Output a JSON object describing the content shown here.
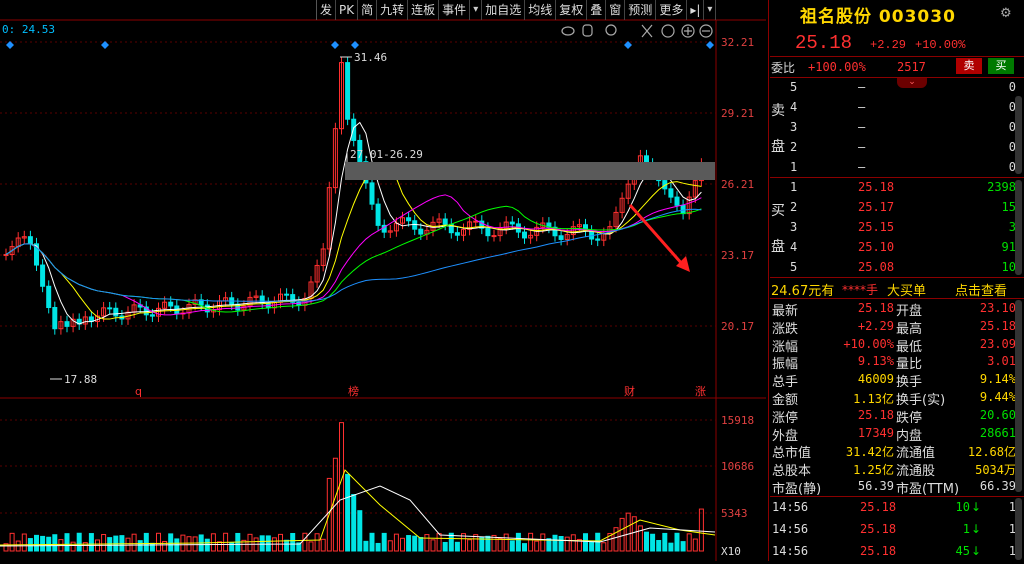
{
  "toolbar": {
    "items": [
      "发",
      "PK",
      "简",
      "九转",
      "连板",
      "事件",
      "▾",
      "加自选",
      "均线",
      "复权",
      "叠",
      "窗",
      "预测",
      "更多",
      "▸|",
      "▾"
    ]
  },
  "chart": {
    "top_left_value": "0: 24.53",
    "price_axis": [
      "32.21",
      "29.21",
      "26.21",
      "23.17",
      "20.17"
    ],
    "volume_axis": [
      "15918",
      "10686",
      "5343",
      "X10"
    ],
    "annotations": {
      "high": "31.46",
      "low": "17.88",
      "range_label": "27.01-26.29"
    },
    "event_markers": [
      "q",
      "榜",
      "财",
      "涨"
    ],
    "tool_icons": [
      "eye-icon",
      "hand-icon",
      "zoom-icon",
      "cut-icon",
      "plus-circle-icon",
      "minus-circle-icon"
    ]
  },
  "stock": {
    "name": "祖名股份",
    "code": "003030",
    "price": "25.18",
    "change": "+2.29",
    "change_pct": "+10.00%"
  },
  "orderbook": {
    "weibi_label": "委比",
    "weibi_value": "+100.00%",
    "weicha_value": "2517",
    "buy_btn": "买",
    "sell_btn": "卖",
    "sell_label_1": "卖",
    "sell_label_2": "盘",
    "buy_label_1": "买",
    "buy_label_2": "盘",
    "asks": [
      {
        "level": "5",
        "price": "–",
        "volume": "0"
      },
      {
        "level": "4",
        "price": "–",
        "volume": "0"
      },
      {
        "level": "3",
        "price": "–",
        "volume": "0"
      },
      {
        "level": "2",
        "price": "–",
        "volume": "0"
      },
      {
        "level": "1",
        "price": "–",
        "volume": "0"
      }
    ],
    "bids": [
      {
        "level": "1",
        "price": "25.18",
        "volume": "2398"
      },
      {
        "level": "2",
        "price": "25.17",
        "volume": "15"
      },
      {
        "level": "3",
        "price": "25.15",
        "volume": "3"
      },
      {
        "level": "4",
        "price": "25.10",
        "volume": "91"
      },
      {
        "level": "5",
        "price": "25.08",
        "volume": "10"
      }
    ]
  },
  "big_order": {
    "price": "24.67元有",
    "mask": "****手",
    "label": "大买单",
    "action": "点击查看"
  },
  "stats": [
    {
      "l1": "最新",
      "v1": "25.18",
      "l2": "开盘",
      "v2": "23.10"
    },
    {
      "l1": "涨跌",
      "v1": "+2.29",
      "l2": "最高",
      "v2": "25.18"
    },
    {
      "l1": "涨幅",
      "v1": "+10.00%",
      "l2": "最低",
      "v2": "23.09"
    },
    {
      "l1": "振幅",
      "v1": "9.13%",
      "l2": "量比",
      "v2": "3.01"
    },
    {
      "l1": "总手",
      "v1": "46009",
      "l2": "换手",
      "v2": "9.14%"
    },
    {
      "l1": "金额",
      "v1": "1.13亿",
      "l2": "换手(实)",
      "v2": "9.44%"
    },
    {
      "l1": "涨停",
      "v1": "25.18",
      "l2": "跌停",
      "v2": "20.60"
    },
    {
      "l1": "外盘",
      "v1": "17349",
      "l2": "内盘",
      "v2": "28661"
    },
    {
      "l1": "总市值",
      "v1": "31.42亿",
      "l2": "流通值",
      "v2": "12.68亿"
    },
    {
      "l1": "总股本",
      "v1": "1.25亿",
      "l2": "流通股",
      "v2": "5034万"
    },
    {
      "l1": "市盈(静)",
      "v1": "56.39",
      "l2": "市盈(TTM)",
      "v2": "66.39"
    }
  ],
  "trades": [
    {
      "time": "14:56",
      "price": "25.18",
      "vol": "10",
      "arrow": "↓",
      "count": "1"
    },
    {
      "time": "14:56",
      "price": "25.18",
      "vol": "1",
      "arrow": "↓",
      "count": "1"
    },
    {
      "time": "14:56",
      "price": "25.18",
      "vol": "45",
      "arrow": "↓",
      "count": "1"
    }
  ],
  "colors": {
    "up": "#ff3030",
    "down": "#00e5e5",
    "text_yellow": "#ffd700",
    "panel_border": "#8b0000"
  }
}
